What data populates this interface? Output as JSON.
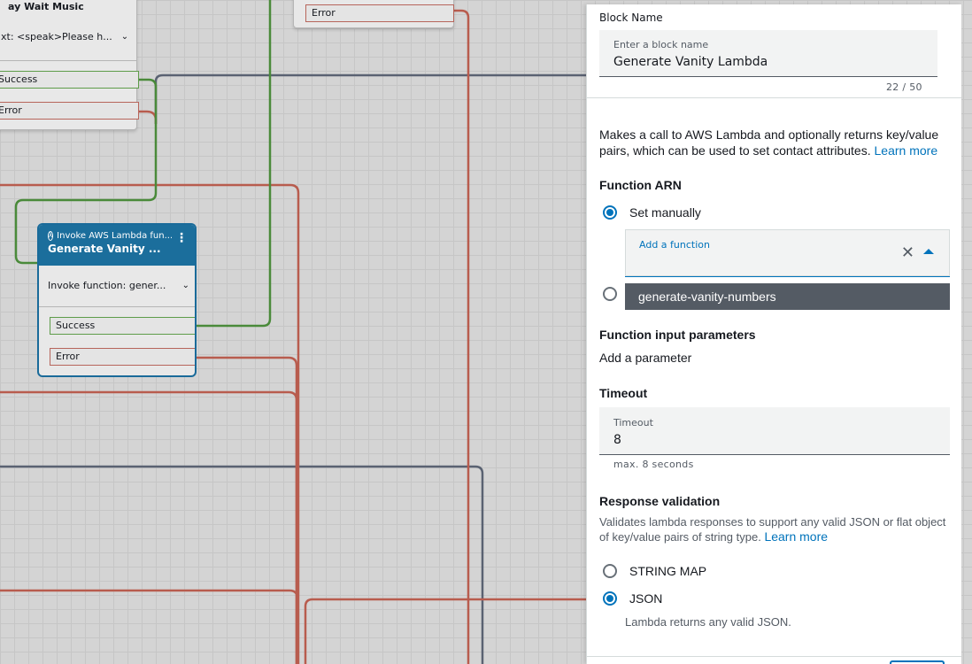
{
  "canvas": {
    "wait_node": {
      "title": "ay Wait Music",
      "summary": "xt: <speak>Please h...",
      "success": "Success",
      "error": "Error"
    },
    "top_node": {
      "error": "Error"
    },
    "lambda_node": {
      "type": "Invoke AWS Lambda fun...",
      "name": "Generate Vanity ...",
      "summary": "Invoke function: gener...",
      "success": "Success",
      "error": "Error"
    }
  },
  "panel": {
    "block_name_label": "Block Name",
    "block_name_field_label": "Enter a block name",
    "block_name_value": "Generate Vanity Lambda",
    "char_count": "22 / 50",
    "description": "Makes a call to AWS Lambda and optionally returns key/value pairs, which can be used to set contact attributes.",
    "learn_more": "Learn more",
    "function_arn_heading": "Function ARN",
    "set_manually_label": "Set manually",
    "add_function_label": "Add a function",
    "function_option": "generate-vanity-numbers",
    "input_params_heading": "Function input parameters",
    "add_parameter": "Add a parameter",
    "timeout_heading": "Timeout",
    "timeout_field_label": "Timeout",
    "timeout_value": "8",
    "timeout_hint": "max. 8 seconds",
    "response_validation_heading": "Response validation",
    "response_validation_desc": "Validates lambda responses to support any valid JSON or flat object of key/value pairs of string type.",
    "response_learn_more": "Learn more",
    "string_map_label": "STRING MAP",
    "json_label": "JSON",
    "json_hint": "Lambda returns any valid JSON."
  },
  "icons": [
    "close-icon",
    "caret-up-icon",
    "lambda-icon",
    "more-vertical-icon",
    "chevron-down-icon"
  ],
  "colors": {
    "accent": "#0073bb",
    "lambda_header": "#1b6e9c",
    "success_wire": "#4a8a3a",
    "error_wire": "#b85c4e",
    "neutral_wire": "#5a6272",
    "selected_option_bg": "#545b64"
  }
}
